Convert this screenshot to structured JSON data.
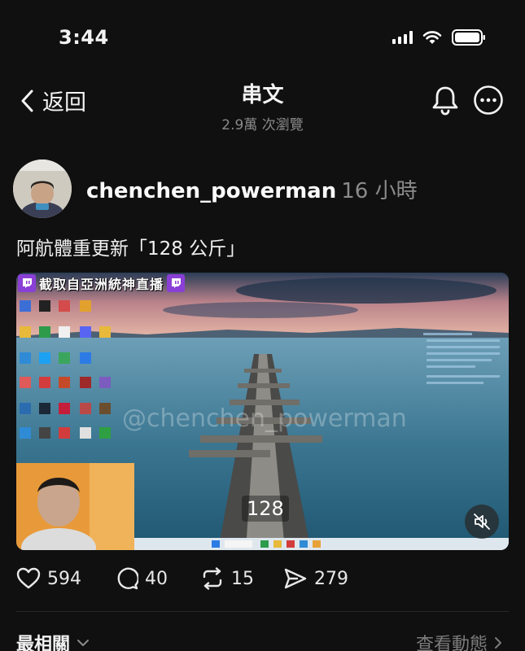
{
  "status_bar": {
    "time": "3:44"
  },
  "header": {
    "back_label": "返回",
    "title": "串文",
    "views": "2.9萬 次瀏覽"
  },
  "post": {
    "username": "chenchen_powerman",
    "time_ago": "16 小時",
    "text": "阿航體重更新「128 公斤」",
    "media": {
      "banner_text": "截取自亞洲統神直播",
      "watermark": "@chenchen_powerman",
      "overlay_label": "128"
    },
    "stats": {
      "likes": "594",
      "comments": "40",
      "reposts": "15",
      "shares": "279"
    }
  },
  "footer": {
    "sort_label": "最相關",
    "view_activity_label": "查看動態"
  },
  "colors": {
    "background": "#101010",
    "muted_text": "#8b8b8b",
    "twitch_purple": "#8a3fd6"
  }
}
